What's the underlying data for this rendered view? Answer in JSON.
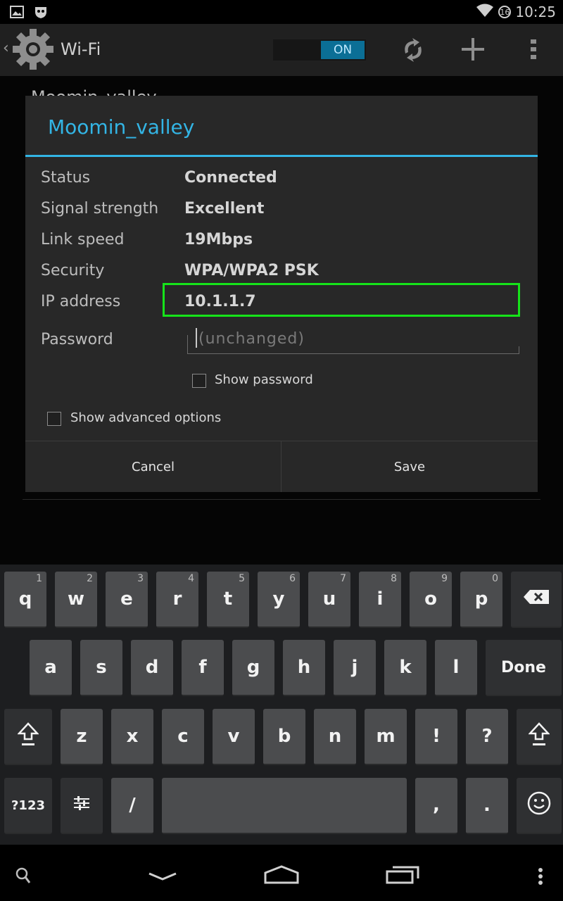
{
  "status_bar": {
    "time": "10:25",
    "badge": "16"
  },
  "action_bar": {
    "back": "‹",
    "title": "Wi-Fi",
    "toggle_label": "ON"
  },
  "background": {
    "network_name": "Moomin_valley"
  },
  "dialog": {
    "title": "Moomin_valley",
    "rows": [
      {
        "label": "Status",
        "value": "Connected"
      },
      {
        "label": "Signal strength",
        "value": "Excellent"
      },
      {
        "label": "Link speed",
        "value": "19Mbps"
      },
      {
        "label": "Security",
        "value": "WPA/WPA2 PSK"
      },
      {
        "label": "IP address",
        "value": "10.1.1.7"
      }
    ],
    "password_label": "Password",
    "password_placeholder": "(unchanged)",
    "show_password": "Show password",
    "show_advanced": "Show advanced options",
    "cancel": "Cancel",
    "save": "Save",
    "highlight_color": "#16e31a",
    "accent_color": "#33b5e5"
  },
  "keyboard": {
    "row1": [
      {
        "k": "q",
        "h": "1"
      },
      {
        "k": "w",
        "h": "2"
      },
      {
        "k": "e",
        "h": "3"
      },
      {
        "k": "r",
        "h": "4"
      },
      {
        "k": "t",
        "h": "5"
      },
      {
        "k": "y",
        "h": "6"
      },
      {
        "k": "u",
        "h": "7"
      },
      {
        "k": "i",
        "h": "8"
      },
      {
        "k": "o",
        "h": "9"
      },
      {
        "k": "p",
        "h": "0"
      }
    ],
    "row2": [
      "a",
      "s",
      "d",
      "f",
      "g",
      "h",
      "j",
      "k",
      "l"
    ],
    "done": "Done",
    "row3": [
      "z",
      "x",
      "c",
      "v",
      "b",
      "n",
      "m",
      "!",
      "?"
    ],
    "symbols": "?123",
    "slash": "/",
    "comma": ",",
    "period": "."
  },
  "icons": {
    "status_left": [
      "picture-icon",
      "notification-app-icon"
    ],
    "status_right": [
      "wifi-signal-icon"
    ],
    "action_bar": [
      "settings-gear-icon",
      "wps-icon",
      "add-network-icon",
      "overflow-menu-icon"
    ],
    "keyboard": [
      "backspace-icon",
      "shift-icon",
      "input-settings-icon",
      "emoji-icon"
    ],
    "nav_bar": [
      "search-icon",
      "back-icon",
      "home-icon",
      "recents-icon",
      "menu-icon"
    ]
  }
}
